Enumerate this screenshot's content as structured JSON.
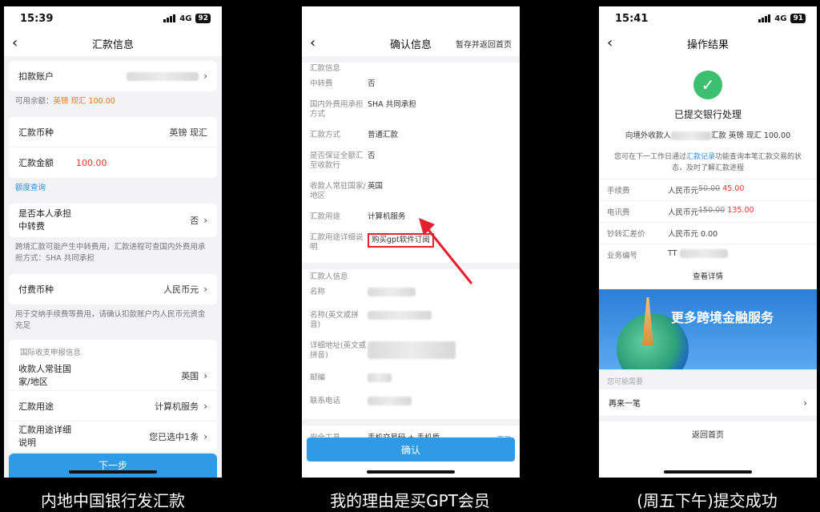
{
  "captions": [
    "内地中国银行发汇款",
    "我的理由是买GPT会员",
    "(周五下午)提交成功"
  ],
  "phone1": {
    "status": {
      "time": "15:39",
      "network": "4G",
      "battery": "92"
    },
    "title": "汇款信息",
    "debit_account_label": "扣款账户",
    "available_label": "可用余额：",
    "available_value": "英镑 现汇 100.00",
    "currency_label": "汇款币种",
    "currency_value": "英镑 现汇",
    "amount_label": "汇款金额",
    "amount_value": "100.00",
    "quota_link": "额度查询",
    "bear_label_1": "是否本人承担",
    "bear_label_2": "中转费",
    "bear_value": "否",
    "bear_note": "跨境汇款可能产生中转费用，汇款进程可查国内外费用承担方式：SHA 共同承担",
    "fee_currency_label": "付费币种",
    "fee_currency_value": "人民币元",
    "fee_note": "用于交纳手续费等费用，请确认扣款账户内人民币元资金充足",
    "section_title": "国际收支申报信息",
    "country_label_1": "收款人常驻国",
    "country_label_2": "家/地区",
    "country_value": "英国",
    "purpose_label": "汇款用途",
    "purpose_value": "计算机服务",
    "purpose_detail_label_1": "汇款用途详细",
    "purpose_detail_label_2": "说明",
    "purpose_detail_value": "您已选中1条",
    "next_button": "下一步"
  },
  "phone2": {
    "status": {
      "time": "",
      "network": "",
      "battery": ""
    },
    "title": "确认信息",
    "action": "暂存并返回首页",
    "section1": "汇款信息",
    "rows": [
      {
        "label": "中转费",
        "value": "否"
      },
      {
        "label": "国内外费用承担方式",
        "value": "SHA 共同承担"
      },
      {
        "label": "汇款方式",
        "value": "普通汇款"
      },
      {
        "label": "是否保证全额汇至收款行",
        "value": "否"
      },
      {
        "label": "收款人常驻国家/地区",
        "value": "英国"
      },
      {
        "label": "汇款用途",
        "value": "计算机服务"
      },
      {
        "label": "汇款用途详细说明",
        "value": "购买gpt软件订阅"
      }
    ],
    "section2": "汇款人信息",
    "payer_rows": [
      "名称",
      "名称(英文或拼音)",
      "详细地址(英文或拼音)",
      "邮编",
      "联系电话"
    ],
    "security_label": "安全工具",
    "security_value": "手机交易码 + 手机盾",
    "security_change": "更改",
    "confirm_button": "确认"
  },
  "phone3": {
    "status": {
      "time": "15:41",
      "network": "4G",
      "battery": "91"
    },
    "title": "操作结果",
    "result_title": "已提交银行处理",
    "result_prefix": "向境外收款人",
    "result_suffix": "汇款 英镑 现汇 100.00",
    "note_before": "您可在下一工作日通过",
    "note_link": "汇款记录",
    "note_after": "功能查询本笔汇款交易的状态，及时了解汇款进程",
    "fees": [
      {
        "label": "手续费",
        "prefix": "人民币元",
        "old": "50.00",
        "new": "45.00"
      },
      {
        "label": "电讯费",
        "prefix": "人民币元",
        "old": "150.00",
        "new": "135.00"
      },
      {
        "label": "钞转汇差价",
        "value": "人民币元 0.00"
      },
      {
        "label": "业务编号",
        "value": "TT"
      }
    ],
    "detail_link": "查看详情",
    "banner_text": "更多跨境金融服务",
    "maybe_label": "您可能需要",
    "again_label": "再来一笔",
    "home_link": "返回首页"
  }
}
